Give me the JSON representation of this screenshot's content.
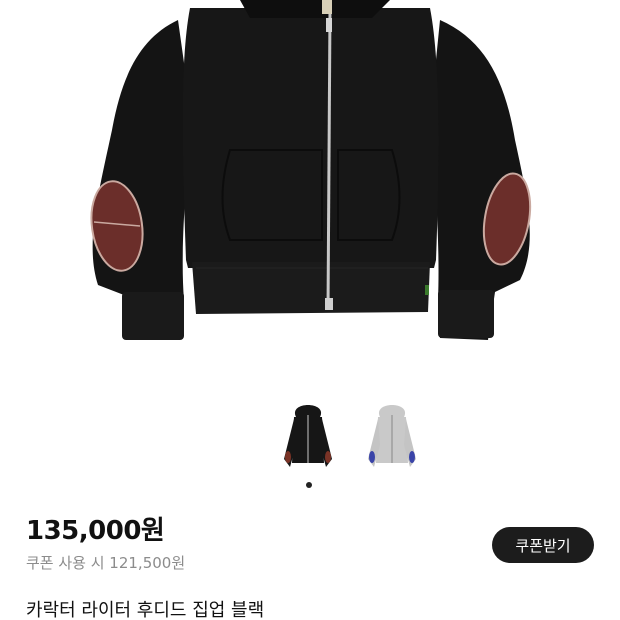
{
  "gallery": {
    "main_image_icon": "black-zip-hoodie-with-elbow-patches",
    "thumbnails": [
      {
        "icon": "black-hoodie-thumbnail",
        "body_color": "#161616",
        "patch_color": "#7a3326"
      },
      {
        "icon": "gray-hoodie-thumbnail",
        "body_color": "#c9c9c9",
        "patch_color": "#3a44a8"
      }
    ],
    "selected_index": 1,
    "total_indicators": 1
  },
  "product": {
    "price": "135,000원",
    "coupon_price": "쿠폰 사용 시 121,500원",
    "coupon_button_label": "쿠폰받기",
    "name": "카락터 라이터 후디드 집업 블랙"
  },
  "colors": {
    "hoodie_body": "#151515",
    "patch": "#6b2e2a",
    "zipper": "#c8c8c8",
    "button_bg": "#1c1c1c",
    "muted_text": "#8c8c8c"
  }
}
